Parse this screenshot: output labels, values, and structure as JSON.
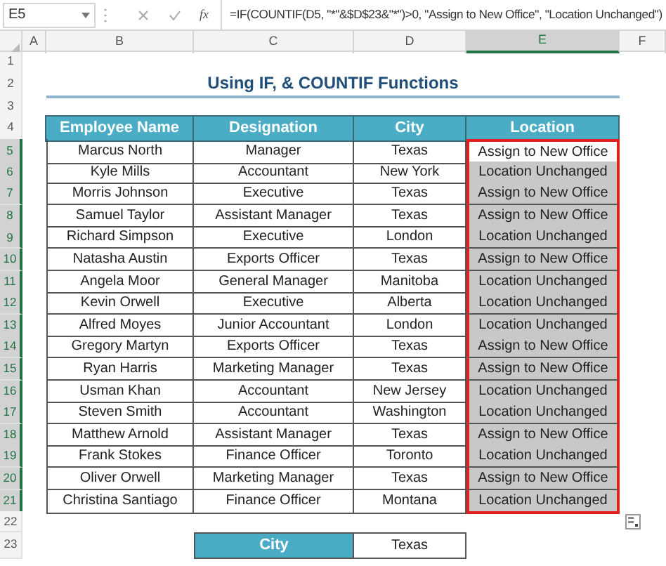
{
  "name_box": "E5",
  "function_label": "fx",
  "formula": "=IF(COUNTIF(D5, \"*\"&$D$23&\"*\")>0, \"Assign to New Office\", \"Location Unchanged\")",
  "column_headers": [
    {
      "label": "A",
      "selected": false
    },
    {
      "label": "B",
      "selected": false
    },
    {
      "label": "C",
      "selected": false
    },
    {
      "label": "D",
      "selected": false
    },
    {
      "label": "E",
      "selected": true
    },
    {
      "label": "F",
      "selected": false
    }
  ],
  "rows": [
    {
      "kind": "blank",
      "label": "1",
      "selected": false
    },
    {
      "kind": "title",
      "label": "2",
      "selected": false,
      "text": "Using IF, & COUNTIF Functions"
    },
    {
      "kind": "blank",
      "label": "3",
      "selected": false
    },
    {
      "kind": "header",
      "label": "4",
      "selected": false,
      "cells": [
        "Employee Name",
        "Designation",
        "City",
        "Location"
      ]
    },
    {
      "kind": "data",
      "label": "5",
      "selected": true,
      "active": true,
      "cells": [
        "Marcus North",
        "Manager",
        "Texas",
        "Assign to New Office"
      ]
    },
    {
      "kind": "data",
      "label": "6",
      "selected": true,
      "active": false,
      "cells": [
        "Kyle Mills",
        "Accountant",
        "New York",
        "Location Unchanged"
      ]
    },
    {
      "kind": "data",
      "label": "7",
      "selected": true,
      "active": false,
      "cells": [
        "Morris Johnson",
        "Executive",
        "Texas",
        "Assign to New Office"
      ]
    },
    {
      "kind": "data",
      "label": "8",
      "selected": true,
      "active": false,
      "cells": [
        "Samuel Taylor",
        "Assistant Manager",
        "Texas",
        "Assign to New Office"
      ]
    },
    {
      "kind": "data",
      "label": "9",
      "selected": true,
      "active": false,
      "cells": [
        "Richard Simpson",
        "Executive",
        "London",
        "Location Unchanged"
      ]
    },
    {
      "kind": "data",
      "label": "10",
      "selected": true,
      "active": false,
      "cells": [
        "Natasha Austin",
        "Exports Officer",
        "Texas",
        "Assign to New Office"
      ]
    },
    {
      "kind": "data",
      "label": "11",
      "selected": true,
      "active": false,
      "cells": [
        "Angela Moor",
        "General Manager",
        "Manitoba",
        "Location Unchanged"
      ]
    },
    {
      "kind": "data",
      "label": "12",
      "selected": true,
      "active": false,
      "cells": [
        "Kevin Orwell",
        "Executive",
        "Alberta",
        "Location Unchanged"
      ]
    },
    {
      "kind": "data",
      "label": "13",
      "selected": true,
      "active": false,
      "cells": [
        "Alfred Moyes",
        "Junior Accountant",
        "London",
        "Location Unchanged"
      ]
    },
    {
      "kind": "data",
      "label": "14",
      "selected": true,
      "active": false,
      "cells": [
        "Gregory Martyn",
        "Exports Officer",
        "Texas",
        "Assign to New Office"
      ]
    },
    {
      "kind": "data",
      "label": "15",
      "selected": true,
      "active": false,
      "cells": [
        "Ryan Harris",
        "Marketing Manager",
        "Texas",
        "Assign to New Office"
      ]
    },
    {
      "kind": "data",
      "label": "16",
      "selected": true,
      "active": false,
      "cells": [
        "Usman Khan",
        "Accountant",
        "New Jersey",
        "Location Unchanged"
      ]
    },
    {
      "kind": "data",
      "label": "17",
      "selected": true,
      "active": false,
      "cells": [
        "Steven Smith",
        "Accountant",
        "Washington",
        "Location Unchanged"
      ]
    },
    {
      "kind": "data",
      "label": "18",
      "selected": true,
      "active": false,
      "cells": [
        "Matthew Arnold",
        "Assistant Manager",
        "Texas",
        "Assign to New Office"
      ]
    },
    {
      "kind": "data",
      "label": "19",
      "selected": true,
      "active": false,
      "cells": [
        "Frank Stokes",
        "Finance Officer",
        "Toronto",
        "Location Unchanged"
      ]
    },
    {
      "kind": "data",
      "label": "20",
      "selected": true,
      "active": false,
      "cells": [
        "Oliver Orwell",
        "Marketing Manager",
        "Texas",
        "Assign to New Office"
      ]
    },
    {
      "kind": "data",
      "label": "21",
      "selected": true,
      "active": false,
      "cells": [
        "Christina Santiago",
        "Finance Officer",
        "Montana",
        "Location Unchanged"
      ]
    },
    {
      "kind": "options",
      "label": "22",
      "selected": false
    },
    {
      "kind": "lookup",
      "label": "23",
      "selected": false,
      "cells": [
        "City",
        "Texas"
      ]
    }
  ]
}
